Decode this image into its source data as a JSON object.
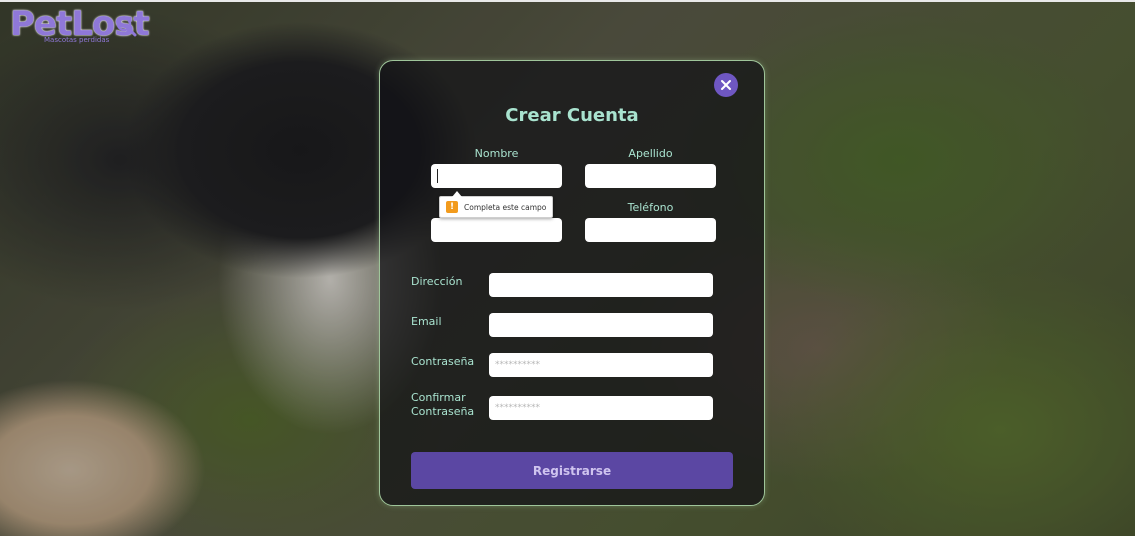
{
  "logo": {
    "text": "PetLost",
    "subtitle": "Mascotas perdidas"
  },
  "modal": {
    "title": "Crear Cuenta",
    "close_icon": "close-icon",
    "fields": {
      "nombre": {
        "label": "Nombre",
        "value": ""
      },
      "apellido": {
        "label": "Apellido",
        "value": ""
      },
      "telefono": {
        "label": "Teléfono",
        "value": ""
      },
      "direccion": {
        "label": "Dirección",
        "value": ""
      },
      "email": {
        "label": "Email",
        "value": ""
      },
      "contrasena": {
        "label": "Contraseña",
        "placeholder": "**********"
      },
      "confirmar": {
        "label_line1": "Confirmar",
        "label_line2": "Contraseña",
        "placeholder": "**********"
      }
    },
    "tooltip": {
      "icon": "warning-icon",
      "text": "Completa este campo"
    },
    "submit_label": "Registrarse"
  },
  "colors": {
    "accent": "#5b47a3",
    "label": "#a9e3cf",
    "border": "#9fc59a",
    "warning": "#f29b1d"
  }
}
